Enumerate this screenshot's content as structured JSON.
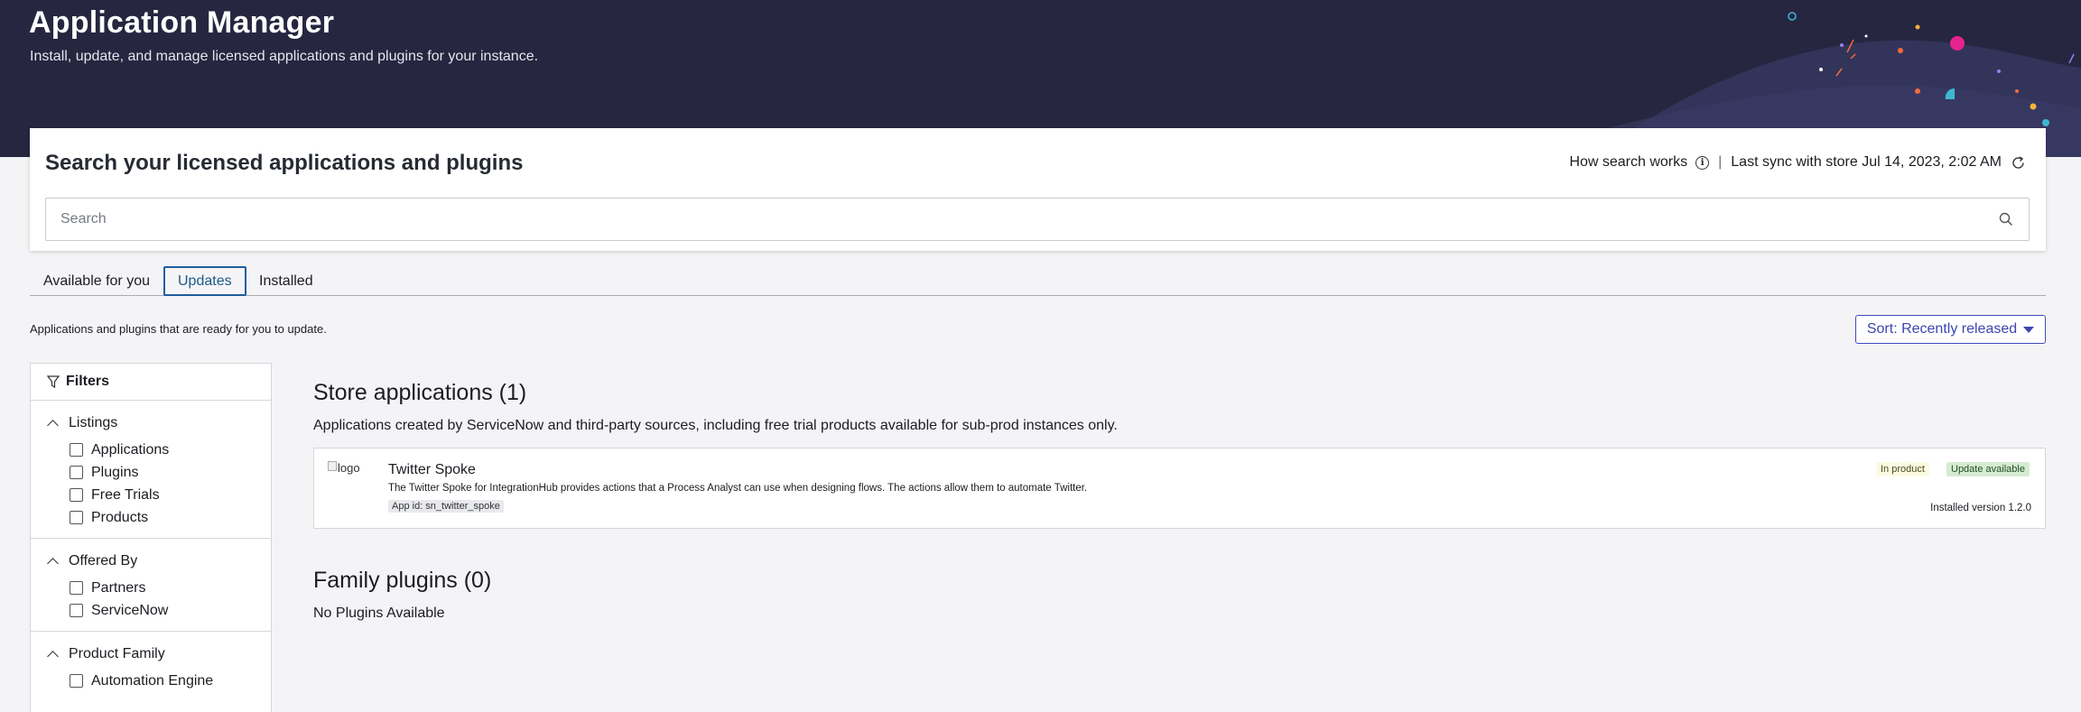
{
  "header": {
    "title": "Application Manager",
    "subtitle": "Install, update, and manage licensed applications and plugins for your instance."
  },
  "search": {
    "title": "Search your licensed applications and plugins",
    "how_link": "How search works",
    "separator": "|",
    "last_sync": "Last sync with store Jul 14, 2023, 2:02 AM",
    "placeholder": "Search"
  },
  "tabs": [
    {
      "label": "Available for you",
      "active": false
    },
    {
      "label": "Updates",
      "active": true
    },
    {
      "label": "Installed",
      "active": false
    }
  ],
  "page_description": "Applications and plugins that are ready for you to update.",
  "sort": {
    "label": "Sort: Recently released"
  },
  "filters": {
    "title": "Filters",
    "groups": [
      {
        "title": "Listings",
        "options": [
          "Applications",
          "Plugins",
          "Free Trials",
          "Products"
        ]
      },
      {
        "title": "Offered By",
        "options": [
          "Partners",
          "ServiceNow"
        ]
      },
      {
        "title": "Product Family",
        "options": [
          "Automation Engine"
        ]
      }
    ]
  },
  "store_section": {
    "title": "Store applications (1)",
    "description": "Applications created by ServiceNow and third-party sources, including free trial products available for sub-prod instances only.",
    "apps": [
      {
        "logo_alt": "logo",
        "name": "Twitter Spoke",
        "description": "The Twitter Spoke for IntegrationHub provides actions that a Process Analyst can use when designing flows. The actions allow them to automate Twitter.",
        "app_id": "App id: sn_twitter_spoke",
        "badges": [
          "In product",
          "Update available"
        ],
        "installed_version": "Installed version 1.2.0"
      }
    ]
  },
  "family_section": {
    "title": "Family plugins (0)",
    "empty_text": "No Plugins Available"
  },
  "colors": {
    "hero_bg": "#262640",
    "accent": "#3d45b0",
    "tab_active": "#1f5d9d",
    "badge_in_product": "#fbfbe2",
    "badge_update": "#d6ecd2"
  }
}
